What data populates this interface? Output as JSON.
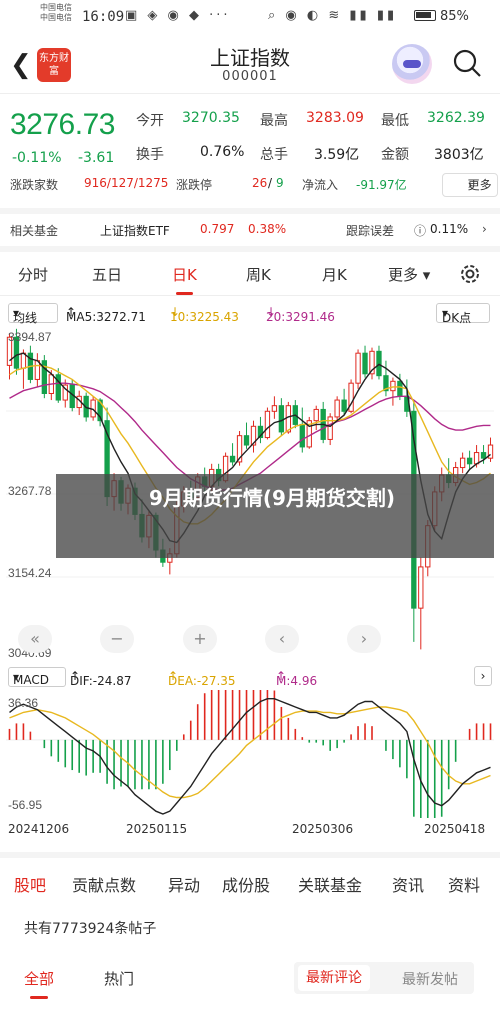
{
  "status": {
    "carrier1": "中国电信",
    "carrier2": "中国电信",
    "time": "16:09",
    "signal": "5G",
    "battery": "85%"
  },
  "nav": {
    "logo_text": "东方财富",
    "title": "上证指数",
    "code": "000001"
  },
  "quote": {
    "price": "3276.73",
    "change_pct": "-0.11%",
    "change": "-3.61",
    "open_label": "今开",
    "open": "3270.35",
    "high_label": "最高",
    "high": "3283.09",
    "low_label": "最低",
    "low": "3262.39",
    "turnover_label": "换手",
    "turnover": "0.76%",
    "volume_label": "总手",
    "volume": "3.59亿",
    "amount_label": "金额",
    "amount": "3803亿",
    "updown_label": "涨跌家数",
    "updown": "916/127/1275",
    "limit_label": "涨跌停",
    "limit_up": "26",
    "limit_down": "9",
    "netflow_label": "净流入",
    "netflow": "-91.97亿",
    "more_label": "更多"
  },
  "fund": {
    "label": "相关基金",
    "name": "上证指数ETF",
    "price": "0.797",
    "pct": "0.38%",
    "track_label": "跟踪误差",
    "track": "0.11%"
  },
  "tabs": [
    "分时",
    "五日",
    "日K",
    "周K",
    "月K",
    "更多"
  ],
  "indicators": {
    "type": "均线",
    "ma5": "MA5:3272.71",
    "ma10": "10:3225.43",
    "ma20": "20:3291.46",
    "dk": "DK点"
  },
  "axis": {
    "top": "3394.87",
    "mid": "3267.78",
    "low": "3154.24",
    "bottom": "3040.69",
    "macd_top": "36.36",
    "macd_bottom": "-56.95"
  },
  "macd": {
    "name": "MACD",
    "dif": "DIF:-24.87",
    "dea": "DEA:-27.35",
    "m": "M:4.96"
  },
  "dates": [
    "20241206",
    "20250115",
    "20250306",
    "20250418"
  ],
  "banner": "9月期货行情(9月期货交割)",
  "bottom_tabs": [
    "股吧",
    "贡献点数",
    "异动",
    "成份股",
    "关联基金",
    "资讯",
    "资料"
  ],
  "posts": "共有7773924条帖子",
  "sub_tabs": [
    "全部",
    "热门"
  ],
  "sort": [
    "最新评论",
    "最新发帖"
  ],
  "colors": {
    "up": "#e0281f",
    "down": "#14a04b",
    "ma5": "#222222",
    "ma10": "#e8b820",
    "ma20": "#b02a8a"
  },
  "chart_data": {
    "type": "candlestick",
    "ylim": [
      3040.69,
      3394.87
    ],
    "candles": [
      [
        3355,
        3389,
        3340,
        3385
      ],
      [
        3385,
        3394,
        3345,
        3352
      ],
      [
        3352,
        3372,
        3330,
        3368
      ],
      [
        3368,
        3376,
        3336,
        3340
      ],
      [
        3340,
        3368,
        3332,
        3360
      ],
      [
        3360,
        3366,
        3320,
        3325
      ],
      [
        3325,
        3350,
        3318,
        3345
      ],
      [
        3345,
        3352,
        3315,
        3318
      ],
      [
        3318,
        3340,
        3310,
        3334
      ],
      [
        3334,
        3340,
        3306,
        3310
      ],
      [
        3310,
        3328,
        3302,
        3322
      ],
      [
        3322,
        3326,
        3295,
        3300
      ],
      [
        3300,
        3322,
        3296,
        3318
      ],
      [
        3318,
        3320,
        3290,
        3296
      ],
      [
        3296,
        3310,
        3205,
        3215
      ],
      [
        3215,
        3240,
        3200,
        3232
      ],
      [
        3232,
        3236,
        3200,
        3208
      ],
      [
        3208,
        3228,
        3196,
        3224
      ],
      [
        3224,
        3230,
        3190,
        3196
      ],
      [
        3196,
        3212,
        3166,
        3172
      ],
      [
        3172,
        3200,
        3160,
        3195
      ],
      [
        3195,
        3198,
        3150,
        3158
      ],
      [
        3158,
        3170,
        3140,
        3145
      ],
      [
        3145,
        3160,
        3132,
        3154
      ],
      [
        3154,
        3210,
        3150,
        3205
      ],
      [
        3205,
        3226,
        3198,
        3220
      ],
      [
        3220,
        3232,
        3208,
        3214
      ],
      [
        3214,
        3240,
        3210,
        3236
      ],
      [
        3236,
        3246,
        3218,
        3226
      ],
      [
        3226,
        3250,
        3220,
        3244
      ],
      [
        3244,
        3250,
        3226,
        3232
      ],
      [
        3232,
        3262,
        3230,
        3258
      ],
      [
        3258,
        3272,
        3248,
        3252
      ],
      [
        3252,
        3285,
        3248,
        3280
      ],
      [
        3280,
        3294,
        3266,
        3270
      ],
      [
        3270,
        3296,
        3262,
        3290
      ],
      [
        3290,
        3300,
        3272,
        3278
      ],
      [
        3278,
        3310,
        3276,
        3306
      ],
      [
        3306,
        3322,
        3298,
        3312
      ],
      [
        3312,
        3320,
        3280,
        3284
      ],
      [
        3284,
        3316,
        3282,
        3312
      ],
      [
        3312,
        3318,
        3288,
        3292
      ],
      [
        3292,
        3310,
        3262,
        3268
      ],
      [
        3268,
        3300,
        3266,
        3296
      ],
      [
        3296,
        3312,
        3286,
        3308
      ],
      [
        3308,
        3316,
        3272,
        3276
      ],
      [
        3276,
        3304,
        3270,
        3300
      ],
      [
        3300,
        3322,
        3296,
        3318
      ],
      [
        3318,
        3330,
        3302,
        3306
      ],
      [
        3306,
        3340,
        3304,
        3336
      ],
      [
        3336,
        3372,
        3330,
        3368
      ],
      [
        3368,
        3376,
        3342,
        3346
      ],
      [
        3346,
        3374,
        3340,
        3370
      ],
      [
        3370,
        3376,
        3340,
        3344
      ],
      [
        3344,
        3360,
        3322,
        3328
      ],
      [
        3328,
        3342,
        3312,
        3338
      ],
      [
        3338,
        3346,
        3318,
        3322
      ],
      [
        3322,
        3340,
        3300,
        3306
      ],
      [
        3306,
        3318,
        3060,
        3096
      ],
      [
        3096,
        3150,
        3052,
        3140
      ],
      [
        3140,
        3190,
        3130,
        3184
      ],
      [
        3184,
        3226,
        3178,
        3220
      ],
      [
        3220,
        3246,
        3210,
        3238
      ],
      [
        3238,
        3256,
        3224,
        3230
      ],
      [
        3230,
        3252,
        3226,
        3246
      ],
      [
        3246,
        3262,
        3240,
        3256
      ],
      [
        3256,
        3264,
        3244,
        3250
      ],
      [
        3250,
        3270,
        3246,
        3262
      ],
      [
        3262,
        3270,
        3250,
        3256
      ],
      [
        3256,
        3278,
        3252,
        3270
      ]
    ],
    "ma5": [
      3360,
      3366,
      3368,
      3362,
      3360,
      3352,
      3346,
      3338,
      3330,
      3324,
      3318,
      3310,
      3308,
      3300,
      3282,
      3266,
      3252,
      3240,
      3218,
      3210,
      3200,
      3190,
      3180,
      3168,
      3166,
      3176,
      3188,
      3200,
      3216,
      3226,
      3234,
      3240,
      3246,
      3256,
      3264,
      3272,
      3280,
      3288,
      3294,
      3296,
      3300,
      3302,
      3296,
      3290,
      3292,
      3292,
      3290,
      3296,
      3302,
      3314,
      3328,
      3340,
      3350,
      3356,
      3352,
      3346,
      3340,
      3330,
      3276,
      3232,
      3196,
      3178,
      3170,
      3196,
      3220,
      3234,
      3244,
      3250,
      3254,
      3260
    ],
    "ma10": [
      3345,
      3350,
      3352,
      3354,
      3355,
      3354,
      3352,
      3348,
      3344,
      3340,
      3334,
      3328,
      3322,
      3316,
      3306,
      3294,
      3282,
      3272,
      3260,
      3248,
      3236,
      3224,
      3214,
      3202,
      3194,
      3188,
      3186,
      3186,
      3190,
      3196,
      3204,
      3212,
      3222,
      3232,
      3242,
      3252,
      3260,
      3268,
      3274,
      3280,
      3286,
      3290,
      3292,
      3292,
      3294,
      3296,
      3296,
      3296,
      3298,
      3302,
      3308,
      3314,
      3320,
      3326,
      3330,
      3332,
      3332,
      3330,
      3316,
      3300,
      3284,
      3268,
      3252,
      3242,
      3236,
      3232,
      3228,
      3230,
      3234,
      3240
    ],
    "ma20": [
      3320,
      3324,
      3328,
      3330,
      3332,
      3334,
      3335,
      3336,
      3336,
      3335,
      3334,
      3332,
      3330,
      3327,
      3322,
      3317,
      3310,
      3303,
      3295,
      3286,
      3278,
      3270,
      3262,
      3254,
      3246,
      3240,
      3234,
      3230,
      3226,
      3224,
      3222,
      3222,
      3224,
      3228,
      3232,
      3236,
      3240,
      3246,
      3252,
      3258,
      3264,
      3270,
      3276,
      3280,
      3284,
      3288,
      3292,
      3295,
      3297,
      3300,
      3304,
      3308,
      3312,
      3316,
      3319,
      3321,
      3322,
      3322,
      3318,
      3312,
      3305,
      3298,
      3292,
      3288,
      3286,
      3286,
      3288,
      3290,
      3291,
      3291
    ],
    "macd_ylim": [
      -56.95,
      36.36
    ],
    "dif": [
      20,
      24,
      26,
      24,
      22,
      18,
      14,
      10,
      6,
      2,
      -2,
      -6,
      -8,
      -12,
      -20,
      -26,
      -30,
      -34,
      -40,
      -44,
      -48,
      -52,
      -54,
      -52,
      -46,
      -40,
      -34,
      -26,
      -18,
      -10,
      -4,
      2,
      8,
      14,
      20,
      24,
      28,
      30,
      30,
      28,
      26,
      24,
      22,
      20,
      20,
      18,
      16,
      16,
      18,
      22,
      26,
      28,
      28,
      24,
      20,
      16,
      12,
      6,
      -14,
      -30,
      -40,
      -46,
      -48,
      -44,
      -38,
      -32,
      -28,
      -24,
      -22,
      -20
    ],
    "dea": [
      16,
      18,
      20,
      21,
      22,
      21,
      20,
      18,
      16,
      13,
      10,
      7,
      4,
      0,
      -4,
      -8,
      -13,
      -17,
      -22,
      -26,
      -30,
      -34,
      -38,
      -41,
      -42,
      -42,
      -41,
      -39,
      -35,
      -30,
      -25,
      -20,
      -15,
      -10,
      -4,
      0,
      4,
      8,
      12,
      16,
      18,
      20,
      21,
      21,
      21,
      20,
      20,
      19,
      19,
      20,
      21,
      22,
      23,
      24,
      24,
      23,
      22,
      20,
      14,
      6,
      -2,
      -12,
      -20,
      -26,
      -30,
      -32,
      -32,
      -30,
      -28,
      -26
    ]
  }
}
